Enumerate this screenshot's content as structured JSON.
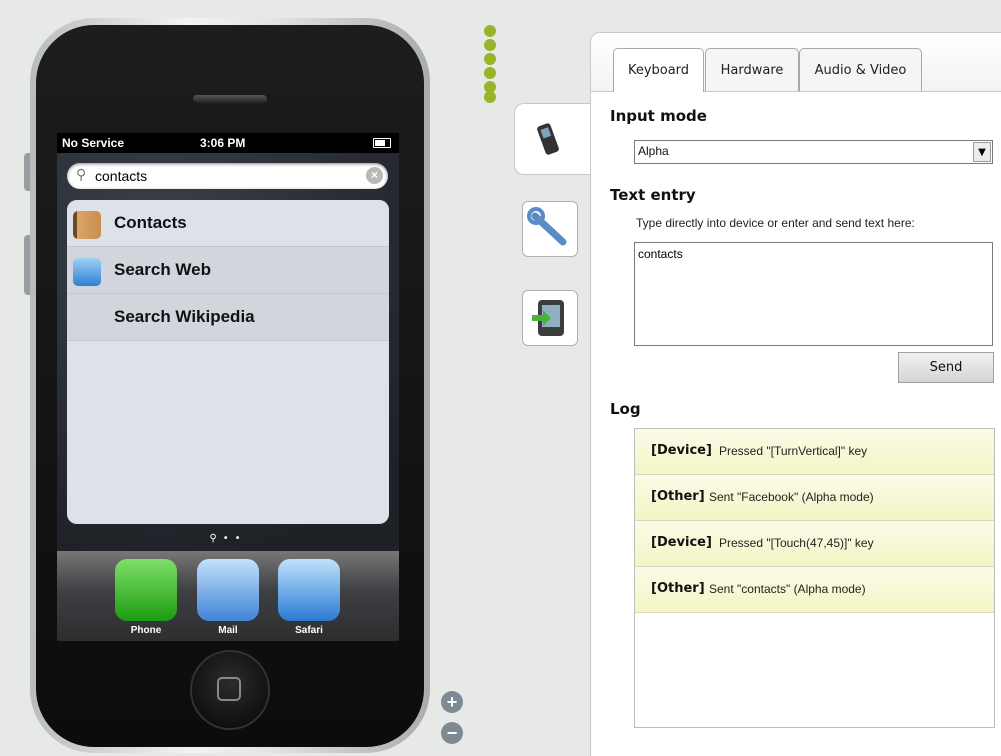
{
  "phone": {
    "status": {
      "carrier": "No Service",
      "time": "3:06 PM"
    },
    "search_value": "contacts",
    "results": [
      {
        "label": "Contacts",
        "icon": "contacts-icon"
      },
      {
        "label": "Search Web",
        "icon": "safari-icon"
      },
      {
        "label": "Search Wikipedia",
        "icon": ""
      }
    ],
    "dock": [
      {
        "label": "Phone",
        "color": "#2fbf1e"
      },
      {
        "label": "Mail",
        "color": "#3f84d6"
      },
      {
        "label": "Safari",
        "color": "#3b8fe2"
      }
    ]
  },
  "panel": {
    "tabs": [
      "Keyboard",
      "Hardware",
      "Audio & Video"
    ],
    "active_tab": "Keyboard",
    "input_mode": {
      "heading": "Input mode",
      "value": "Alpha"
    },
    "text_entry": {
      "heading": "Text entry",
      "hint": "Type directly into device or enter and send text here:",
      "value": "contacts",
      "send_label": "Send"
    },
    "log": {
      "heading": "Log",
      "entries": [
        {
          "source": "[Device]",
          "message": "Pressed \"[TurnVertical]\" key"
        },
        {
          "source": "[Other]",
          "message": "Sent \"Facebook\" (Alpha mode)"
        },
        {
          "source": "[Device]",
          "message": "Pressed \"[Touch(47,45)]\" key"
        },
        {
          "source": "[Other]",
          "message": "Sent \"contacts\" (Alpha mode)"
        }
      ]
    }
  },
  "colors": {
    "accent_green": "#97b42a",
    "log_row": "#f6f6c8"
  }
}
